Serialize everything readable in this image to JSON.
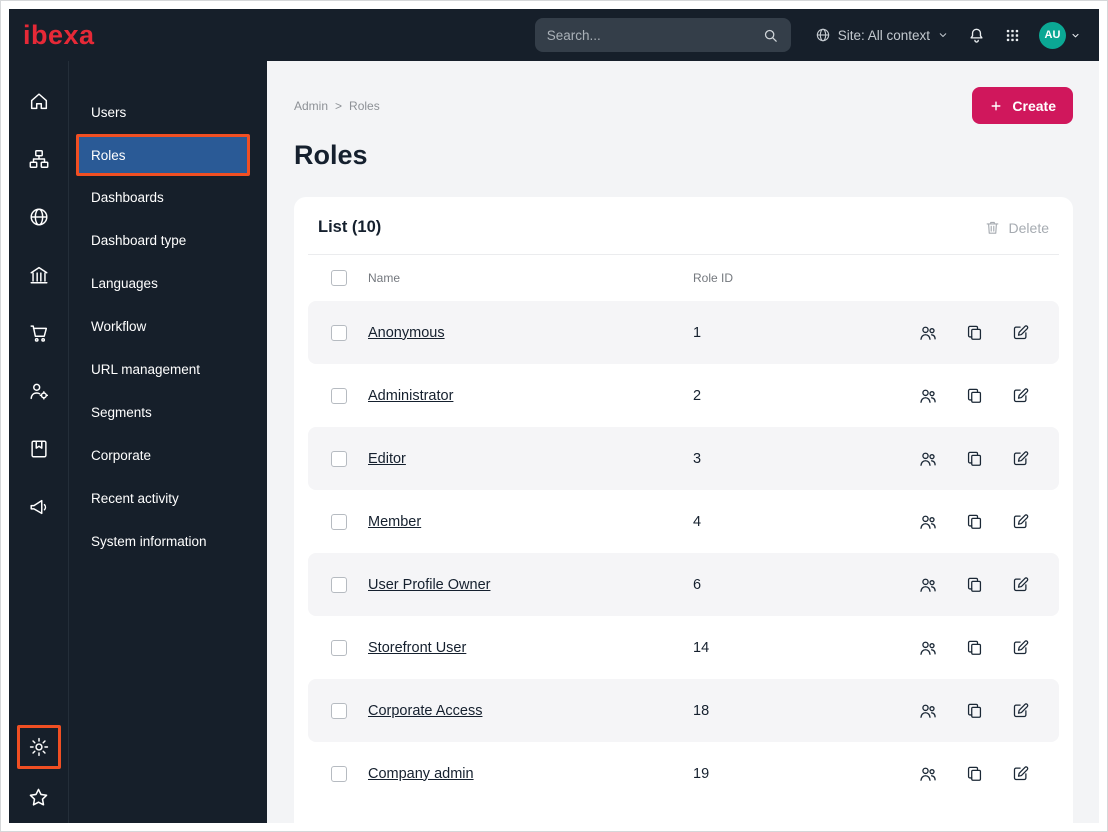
{
  "topbar": {
    "logo_text": "ibexa",
    "search_placeholder": "Search...",
    "site_context_label": "Site: All context",
    "avatar_initials": "AU"
  },
  "icon_rail": {
    "items": [
      "home",
      "content-tree",
      "globe",
      "company",
      "cart",
      "customers",
      "catalog",
      "marketing"
    ],
    "bottom_items": [
      "settings-gear",
      "bookmarks-star"
    ],
    "highlighted_item": "settings-gear"
  },
  "sidebar": {
    "items": [
      {
        "label": "Users",
        "active": false
      },
      {
        "label": "Roles",
        "active": true
      },
      {
        "label": "Dashboards",
        "active": false
      },
      {
        "label": "Dashboard type",
        "active": false
      },
      {
        "label": "Languages",
        "active": false
      },
      {
        "label": "Workflow",
        "active": false
      },
      {
        "label": "URL management",
        "active": false
      },
      {
        "label": "Segments",
        "active": false
      },
      {
        "label": "Corporate",
        "active": false
      },
      {
        "label": "Recent activity",
        "active": false
      },
      {
        "label": "System information",
        "active": false
      }
    ]
  },
  "main": {
    "breadcrumb": {
      "items": [
        "Admin",
        "Roles"
      ],
      "separator": ">"
    },
    "title": "Roles",
    "create_button_label": "Create",
    "list": {
      "title": "List (10)",
      "delete_button_label": "Delete",
      "columns": {
        "name": "Name",
        "role_id": "Role ID"
      },
      "rows": [
        {
          "name": "Anonymous",
          "role_id": "1"
        },
        {
          "name": "Administrator",
          "role_id": "2"
        },
        {
          "name": "Editor",
          "role_id": "3"
        },
        {
          "name": "Member",
          "role_id": "4"
        },
        {
          "name": "User Profile Owner",
          "role_id": "6"
        },
        {
          "name": "Storefront User",
          "role_id": "14"
        },
        {
          "name": "Corporate Access",
          "role_id": "18"
        },
        {
          "name": "Company admin",
          "role_id": "19"
        }
      ]
    }
  },
  "colors": {
    "topbar_bg": "#161f2a",
    "logo_red": "#e62937",
    "primary_button": "#d0175c",
    "active_menu_bg": "#2a5a96",
    "highlight_orange": "#f04f23",
    "avatar_bg": "#0ba894",
    "row_stripe": "#f5f5f7"
  }
}
